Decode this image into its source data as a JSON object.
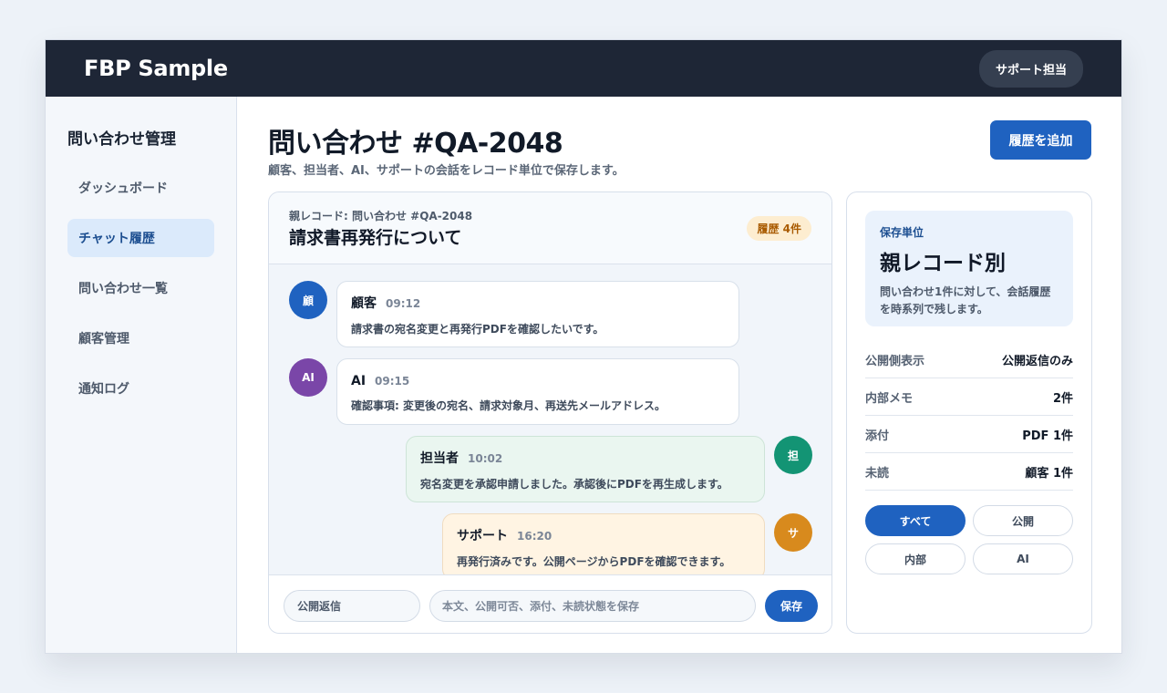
{
  "app": {
    "brand": "FBP Sample",
    "role": "サポート担当"
  },
  "sidebar": {
    "title": "問い合わせ管理",
    "items": [
      {
        "label": "ダッシュボード",
        "active": false
      },
      {
        "label": "チャット履歴",
        "active": true
      },
      {
        "label": "問い合わせ一覧",
        "active": false
      },
      {
        "label": "顧客管理",
        "active": false
      },
      {
        "label": "通知ログ",
        "active": false
      }
    ]
  },
  "header": {
    "title": "問い合わせ #QA-2048",
    "subtitle": "顧客、担当者、AI、サポートの会話をレコード単位で保存します。",
    "add_button": "履歴を追加"
  },
  "chat": {
    "parent_label": "親レコード: 問い合わせ #QA-2048",
    "title": "請求書再発行について",
    "count_badge": "履歴 4件",
    "messages": [
      {
        "avatar": "顧",
        "name": "顧客",
        "time": "09:12",
        "text": "請求書の宛名変更と再発行PDFを確認したいです。",
        "color": "#1f62c0"
      },
      {
        "avatar": "AI",
        "name": "AI",
        "time": "09:15",
        "text": "確認事項: 変更後の宛名、請求対象月、再送先メールアドレス。",
        "color": "#7a46a8"
      },
      {
        "avatar": "担",
        "name": "担当者",
        "time": "10:02",
        "text": "宛名変更を承認申請しました。承認後にPDFを再生成します。",
        "color": "#139474"
      },
      {
        "avatar": "サ",
        "name": "サポート",
        "time": "16:20",
        "text": "再発行済みです。公開ページからPDFを確認できます。",
        "color": "#d88a1d"
      }
    ],
    "visibility_select": "公開返信",
    "input_placeholder": "本文、公開可否、添付、未読状態を保存",
    "save_button": "保存"
  },
  "info": {
    "unit_label": "保存単位",
    "unit_title": "親レコード別",
    "unit_desc_line1": "問い合わせ1件に対して、会話履歴",
    "unit_desc_line2": "を時系列で残します。",
    "stats": [
      {
        "key": "公開側表示",
        "value": "公開返信のみ"
      },
      {
        "key": "内部メモ",
        "value": "2件"
      },
      {
        "key": "添付",
        "value": "PDF 1件"
      },
      {
        "key": "未読",
        "value": "顧客 1件"
      }
    ],
    "filters": [
      {
        "label": "すべて",
        "active": true
      },
      {
        "label": "公開",
        "active": false
      },
      {
        "label": "内部",
        "active": false
      },
      {
        "label": "AI",
        "active": false
      }
    ]
  }
}
